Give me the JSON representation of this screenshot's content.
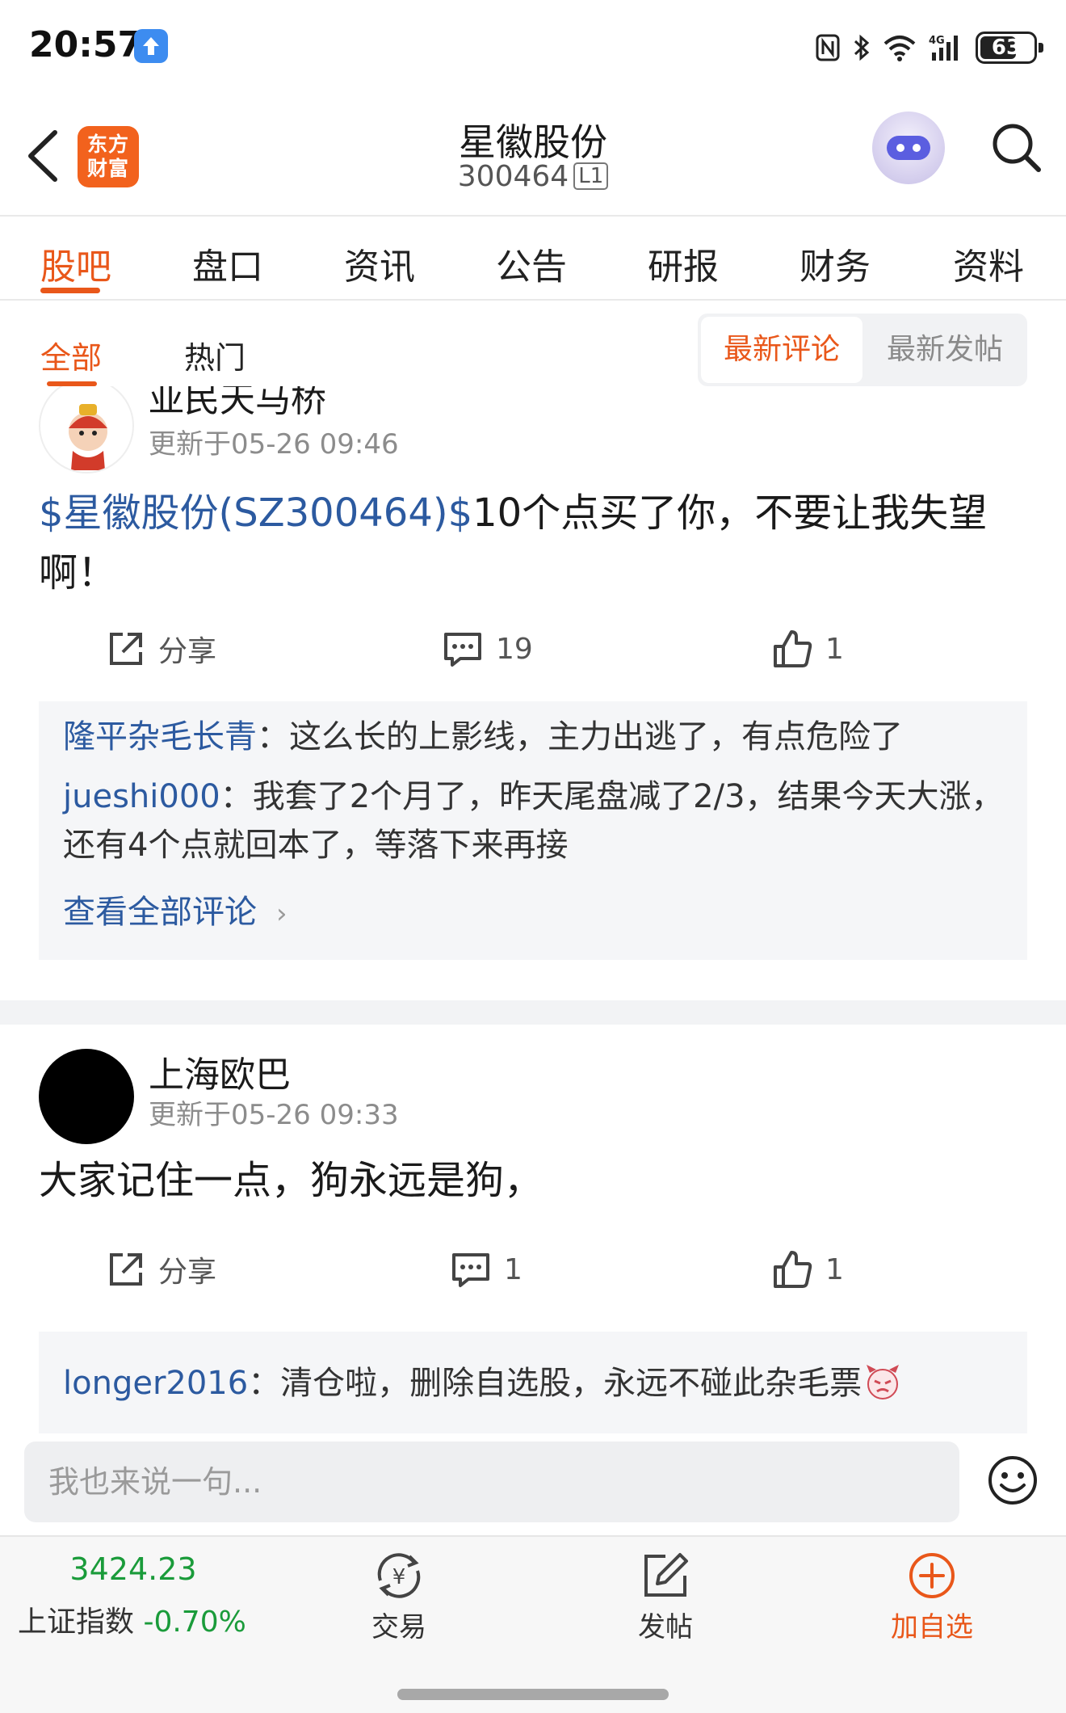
{
  "status_bar": {
    "time": "20:57",
    "battery": "63",
    "icons": [
      "nfc-icon",
      "bluetooth-icon",
      "wifi-icon",
      "4g-signal-icon",
      "battery-icon"
    ]
  },
  "header": {
    "brand_logo_line1": "东方",
    "brand_logo_line2": "财富",
    "stock_name": "星徽股份",
    "stock_code": "300464",
    "level_badge": "L1"
  },
  "main_tabs": [
    {
      "label": "股吧",
      "active": true
    },
    {
      "label": "盘口"
    },
    {
      "label": "资讯"
    },
    {
      "label": "公告"
    },
    {
      "label": "研报"
    },
    {
      "label": "财务"
    },
    {
      "label": "资料"
    }
  ],
  "filter": {
    "tabs": [
      {
        "label": "全部",
        "active": true
      },
      {
        "label": "热门"
      }
    ],
    "sort_options": [
      {
        "label": "最新评论",
        "active": true
      },
      {
        "label": "最新发帖"
      }
    ]
  },
  "posts": [
    {
      "author": "亚民天马桥",
      "time": "更新于05-26 09:46",
      "stock_tag": "$星徽股份(SZ300464)$",
      "body": "10个点买了你，不要让我失望啊！",
      "share_label": "分享",
      "comment_count": "19",
      "like_count": "1",
      "comments": [
        {
          "user": "隆平杂毛长青",
          "text": "：这么长的上影线，主力出逃了，有点危险了"
        },
        {
          "user": "jueshi000",
          "text": "：我套了2个月了，昨天尾盘减了2/3，结果今天大涨，还有4个点就回本了，等落下来再接"
        }
      ],
      "view_all_label": "查看全部评论"
    },
    {
      "author": "上海欧巴",
      "time": "更新于05-26 09:33",
      "body": "大家记住一点，狗永远是狗，",
      "share_label": "分享",
      "comment_count": "1",
      "like_count": "1",
      "comments": [
        {
          "user": "longer2016",
          "text": "：清仓啦，删除自选股，永远不碰此杂毛票"
        }
      ]
    }
  ],
  "reply_bar": {
    "placeholder": "我也来说一句..."
  },
  "bottom_bar": {
    "index_value": "3424.23",
    "index_name": "上证指数",
    "index_change": "-0.70%",
    "items": [
      {
        "label": "交易",
        "icon": "trade-yen-icon"
      },
      {
        "label": "发帖",
        "icon": "compose-icon"
      },
      {
        "label": "加自选",
        "icon": "add-watchlist-icon"
      }
    ]
  },
  "colors": {
    "accent": "#e9571a",
    "link": "#2c5aa0",
    "index_green": "#1a9b3a"
  }
}
